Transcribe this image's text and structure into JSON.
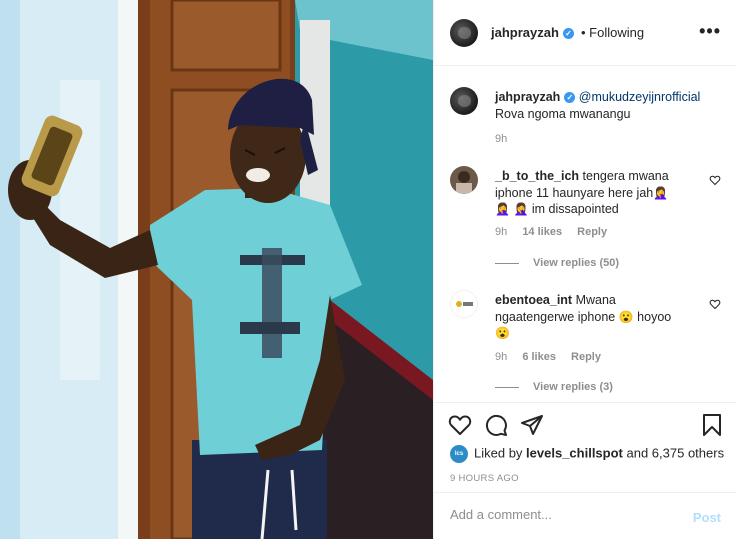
{
  "post": {
    "username": "jahprayzah",
    "follow_status": "• Following",
    "more_icon": "more-horizontal-icon",
    "caption": {
      "username": "jahprayzah",
      "mention": "@mukudzeyijnrofficial",
      "text": "Rova ngoma mwanangu",
      "time": "9h"
    }
  },
  "comments": [
    {
      "username": "_b_to_the_ich",
      "text": "tengera mwana iphone 11 haunyare here jah",
      "text_tail": "im dissapointed",
      "emojis": [
        "🤦‍♀️",
        "🤦‍♀️",
        "🤦‍♀️"
      ],
      "time": "9h",
      "likes": "14 likes",
      "reply": "Reply",
      "view_replies": "View replies (50)"
    },
    {
      "username": "ebentoea_int",
      "text": "Mwana ngaatengerwe iphone",
      "text_mid": "hoyoo",
      "emojis": [
        "😮",
        "😮"
      ],
      "time": "9h",
      "likes": "6 likes",
      "reply": "Reply",
      "view_replies": "View replies (3)"
    }
  ],
  "actions": {
    "icons": [
      "heart-icon",
      "comment-icon",
      "share-icon",
      "bookmark-icon"
    ],
    "liked_by_prefix": "Liked by",
    "liked_by_user": "levels_chillspot",
    "liked_by_suffix": "and 6,375 others",
    "time_ago": "9 HOURS AGO"
  },
  "add_comment": {
    "placeholder": "Add a comment...",
    "post_label": "Post"
  },
  "colors": {
    "link": "#00376b",
    "secondary": "#8e8e8e",
    "post_disabled": "#b2dffc",
    "verified": "#3897f0"
  }
}
